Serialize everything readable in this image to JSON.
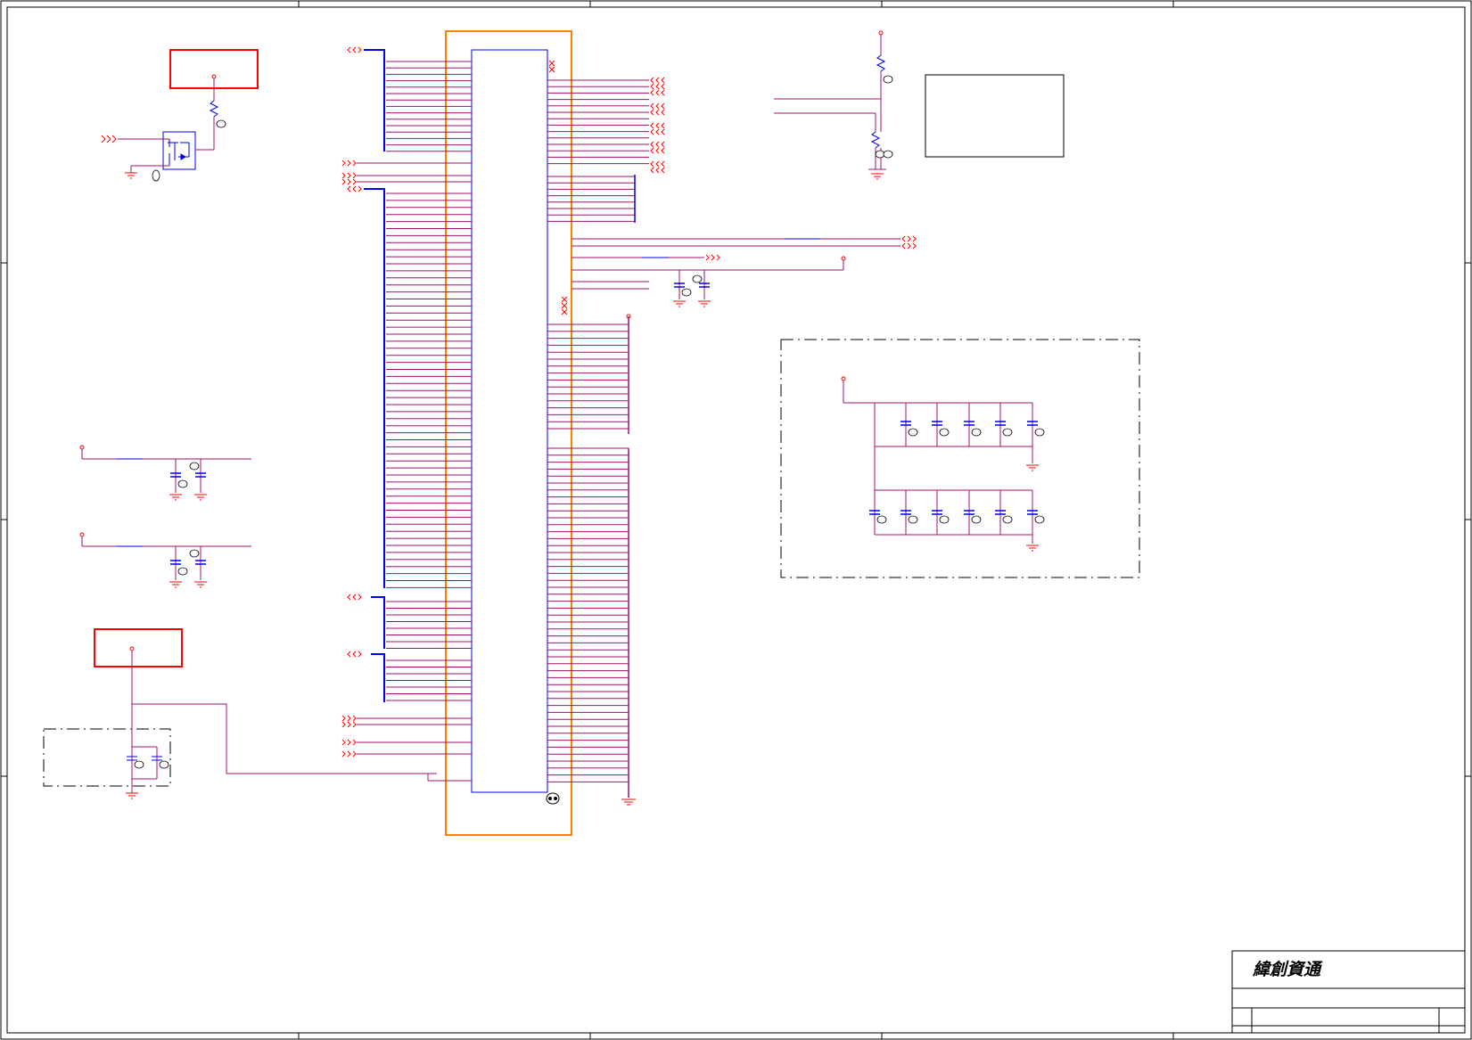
{
  "titleblock": {
    "company": "緯創資通"
  },
  "colors": {
    "border": "#000000",
    "wire": "#a0106a",
    "bus": "#0000ee",
    "net": "#ff0000",
    "connector_outline": "#ff8000",
    "component": "#0000ee",
    "red_box": "#ff0000",
    "ground": "#ff0000"
  },
  "icons": {
    "offpage_right": "triple-chevron-right-icon",
    "offpage_left": "double-chevron-left-icon",
    "ground": "ground-icon",
    "no_connect": "no-connect-x-icon",
    "power_pin": "power-dot-icon"
  }
}
